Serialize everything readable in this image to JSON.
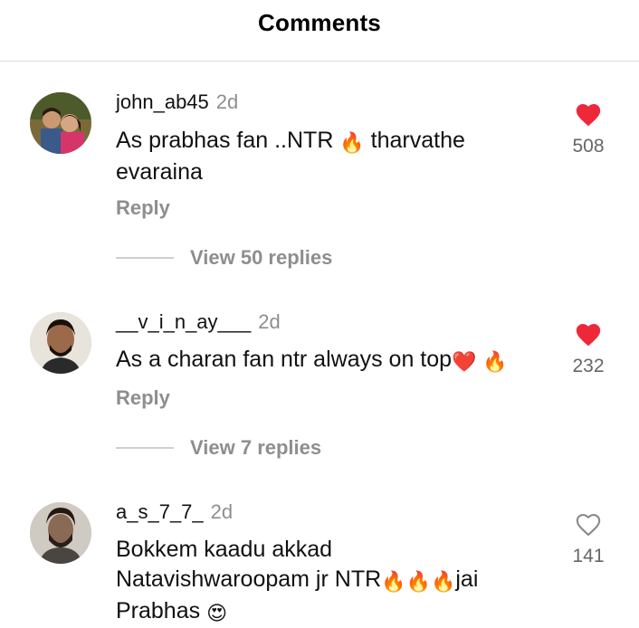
{
  "header": {
    "title": "Comments"
  },
  "comments": [
    {
      "username": "john_ab45",
      "time": "2d",
      "text_parts": [
        "As prabhas fan ..NTR ",
        "🔥",
        " tharvathe evaraina"
      ],
      "reply_label": "Reply",
      "view_replies": "View 50 replies",
      "likes": "508",
      "liked": true
    },
    {
      "username": "__v_i_n_ay___",
      "time": "2d",
      "text_parts": [
        "As a charan fan ntr always on top",
        "❤️",
        " ",
        "🔥"
      ],
      "reply_label": "Reply",
      "view_replies": "View 7 replies",
      "likes": "232",
      "liked": true
    },
    {
      "username": "a_s_7_7_",
      "time": "2d",
      "text_parts": [
        "Bokkem kaadu akkad Natavishwaroopam jr NTR",
        "🔥",
        "🔥",
        "🔥",
        "jai Prabhas ",
        "😍"
      ],
      "likes": "141",
      "liked": false
    }
  ],
  "colors": {
    "like_active": "#ed2939",
    "muted": "#8e8e8e",
    "divider": "#dcdcdc"
  },
  "icons": {
    "liked": "heart-filled-icon",
    "not_liked": "heart-outline-icon"
  }
}
